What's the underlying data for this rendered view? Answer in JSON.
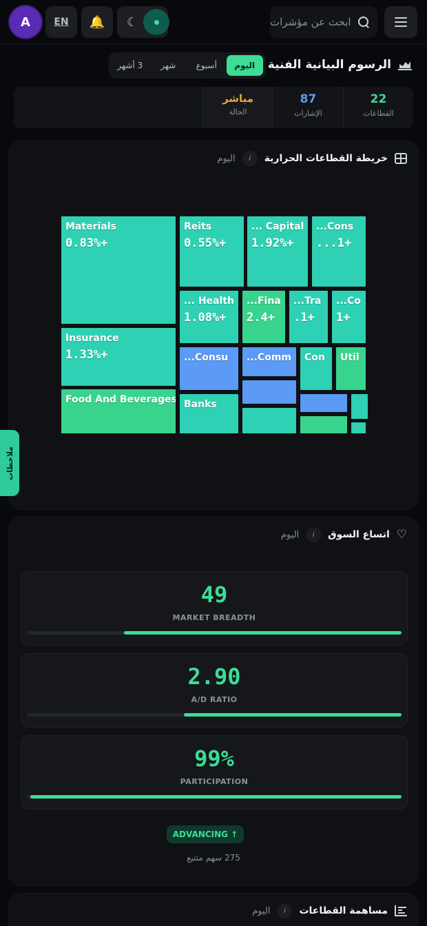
{
  "header": {
    "avatar_initial": "A",
    "lang": "EN",
    "search_placeholder": "ابحث عن مؤشرات"
  },
  "page": {
    "title": "الرسوم البيانية الفنية",
    "periods": [
      "اليوم",
      "أسبوع",
      "شهر",
      "3 أشهر"
    ],
    "active_period": "اليوم"
  },
  "stats": {
    "sectors": {
      "value": "22",
      "label": "القطاعات"
    },
    "signals": {
      "value": "87",
      "label": "الإشارات"
    },
    "status": {
      "value": "مباشر",
      "label": "الحالة"
    }
  },
  "heatmap": {
    "title": "خريطة القطاعات الحرارية",
    "info": "i",
    "period": "اليوم",
    "tiles": [
      {
        "name": "Materials",
        "change": "0.83%+",
        "color": "#2ed1b3"
      },
      {
        "name": "Insurance",
        "change": "1.33%+",
        "color": "#2ed1b3"
      },
      {
        "name": "Food And Beverages",
        "change": "",
        "color": "#38d48e"
      },
      {
        "name": "Reits",
        "change": "0.55%+",
        "color": "#2ed1b3"
      },
      {
        "name": "... Capital",
        "change": "1.92%+",
        "color": "#2ed1b3"
      },
      {
        "name": "...Cons",
        "change": "...1+",
        "color": "#2ed1b3"
      },
      {
        "name": "... Health",
        "change": "1.08%+",
        "color": "#2ed1b3"
      },
      {
        "name": "...Fina",
        "change": "2.4+",
        "color": "#38d48e"
      },
      {
        "name": "...Tra",
        "change": ".1+",
        "color": "#2ed1b3"
      },
      {
        "name": "...Co",
        "change": "1+",
        "color": "#2ed1b3"
      },
      {
        "name": "...Consu",
        "change": "",
        "color": "#5b9bf5"
      },
      {
        "name": "...Comm",
        "change": "",
        "color": "#5b9bf5"
      },
      {
        "name": "Con",
        "change": "",
        "color": "#2ed1b3"
      },
      {
        "name": "Util",
        "change": "",
        "color": "#38d48e"
      },
      {
        "name": "Banks",
        "change": "",
        "color": "#2ed1b3"
      }
    ]
  },
  "notes": {
    "label": "ملاحظات"
  },
  "breadth": {
    "title": "اتساع السوق",
    "info": "i",
    "period": "اليوم",
    "metrics": [
      {
        "value": "49",
        "label": "MARKET BREADTH",
        "fill": 0.74
      },
      {
        "value": "2.90",
        "label": "A/D RATIO",
        "fill": 0.58
      },
      {
        "value": "99%",
        "label": "PARTICIPATION",
        "fill": 0.99
      }
    ],
    "badge": "ADVANCING ↑",
    "subtext": "275 سهم متتبع"
  },
  "contribution": {
    "title": "مساهمة القطاعات",
    "info": "i",
    "period": "اليوم"
  }
}
